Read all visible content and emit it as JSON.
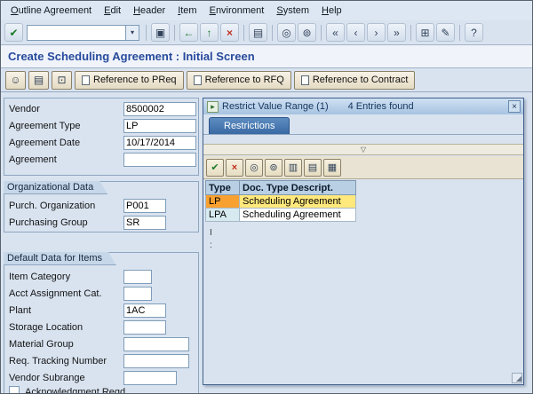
{
  "menu": {
    "items": [
      "Outline Agreement",
      "Edit",
      "Header",
      "Item",
      "Environment",
      "System",
      "Help"
    ]
  },
  "toolbar": {
    "command_value": ""
  },
  "page": {
    "title": "Create Scheduling Agreement : Initial Screen"
  },
  "app_toolbar": {
    "buttons": [
      "Reference to PReq",
      "Reference to RFQ",
      "Reference to Contract"
    ]
  },
  "form": {
    "main_fields": [
      {
        "label": "Vendor",
        "value": "8500002"
      },
      {
        "label": "Agreement Type",
        "value": "LP"
      },
      {
        "label": "Agreement Date",
        "value": "10/17/2014"
      },
      {
        "label": "Agreement",
        "value": ""
      }
    ],
    "organizational": {
      "title": "Organizational Data",
      "fields": [
        {
          "label": "Purch. Organization",
          "value": "P001"
        },
        {
          "label": "Purchasing Group",
          "value": "SR"
        }
      ]
    },
    "defaults": {
      "title": "Default Data for Items",
      "fields": [
        {
          "label": "Item Category",
          "value": ""
        },
        {
          "label": "Acct Assignment Cat.",
          "value": ""
        },
        {
          "label": "Plant",
          "value": "1AC"
        },
        {
          "label": "Storage Location",
          "value": ""
        },
        {
          "label": "Material Group",
          "value": ""
        },
        {
          "label": "Req. Tracking Number",
          "value": ""
        },
        {
          "label": "Vendor Subrange",
          "value": ""
        }
      ],
      "checkbox": {
        "label": "Acknowledgment Reqd",
        "checked": false
      }
    }
  },
  "popup": {
    "title": "Restrict Value Range (1)",
    "status": "4 Entries found",
    "tab": "Restrictions",
    "table": {
      "headers": [
        "Type",
        "Doc. Type Descript."
      ],
      "rows": [
        {
          "type": "LP",
          "description": "Scheduling Agreement",
          "selected": true
        },
        {
          "type": "LPA",
          "description": "Scheduling Agreement",
          "selected": false
        }
      ]
    },
    "stray_marks": [
      "I",
      ":"
    ]
  },
  "icons": {
    "enter": "✔",
    "dropdown": "▾",
    "save": "▣",
    "back": "←",
    "exit": "↑",
    "cancel": "×",
    "print": "▤",
    "find": "◎",
    "find_next": "⊚",
    "first_page": "«",
    "prev_page": "‹",
    "next_page": "›",
    "last_page": "»",
    "new_session": "⊞",
    "shortcut": "✎",
    "help": "?",
    "person": "☺",
    "copy": "⊡",
    "confirm": "✔",
    "close": "×",
    "sort": "▥",
    "table": "▦",
    "filter": "▽",
    "value_range": "▸",
    "grip": "◢"
  },
  "colors": {
    "title_text": "#274a9c",
    "selected_key_bg": "#f8a030",
    "selected_desc_bg": "#ffe87c",
    "tab_bg": "#3a6aa4",
    "window_bg": "#d9e3f0"
  }
}
